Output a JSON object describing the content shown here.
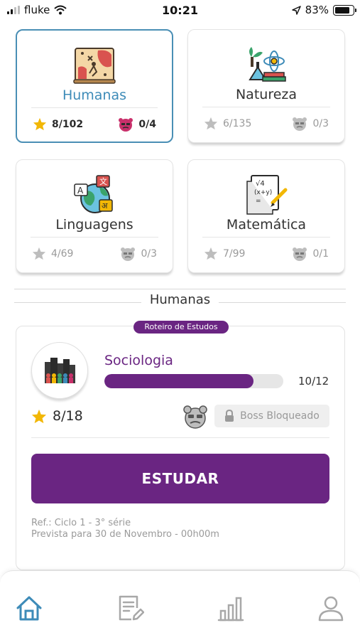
{
  "status_bar": {
    "carrier": "fluke",
    "time": "10:21",
    "battery_percent": "83%",
    "battery_level": 0.83
  },
  "subjects": [
    {
      "name": "Humanas",
      "stars": "8/102",
      "boss": "0/4",
      "icon": "map-icon",
      "selected": true
    },
    {
      "name": "Natureza",
      "stars": "6/135",
      "boss": "0/3",
      "icon": "science-icon",
      "selected": false
    },
    {
      "name": "Linguagens",
      "stars": "4/69",
      "boss": "0/3",
      "icon": "languages-globe-icon",
      "selected": false
    },
    {
      "name": "Matemática",
      "stars": "7/99",
      "boss": "0/1",
      "icon": "math-paper-icon",
      "selected": false
    }
  ],
  "section_title": "Humanas",
  "study": {
    "badge": "Roteiro de Estudos",
    "subject": "Sociologia",
    "progress_text": "10/12",
    "progress_fraction": 0.833,
    "stars": "8/18",
    "boss_status": "Boss Bloqueado",
    "button_label": "ESTUDAR",
    "ref_line1": "Ref.: Ciclo 1 - 3° série",
    "ref_line2": "Prevista para 30 de Novembro - 00h00m"
  },
  "nav": [
    "home-icon",
    "notes-icon",
    "stats-icon",
    "profile-icon"
  ],
  "colors": {
    "purple": "#6a2582",
    "blue": "#3d8bb8",
    "star_gold": "#f2b705",
    "boss_pink": "#c9306b"
  }
}
